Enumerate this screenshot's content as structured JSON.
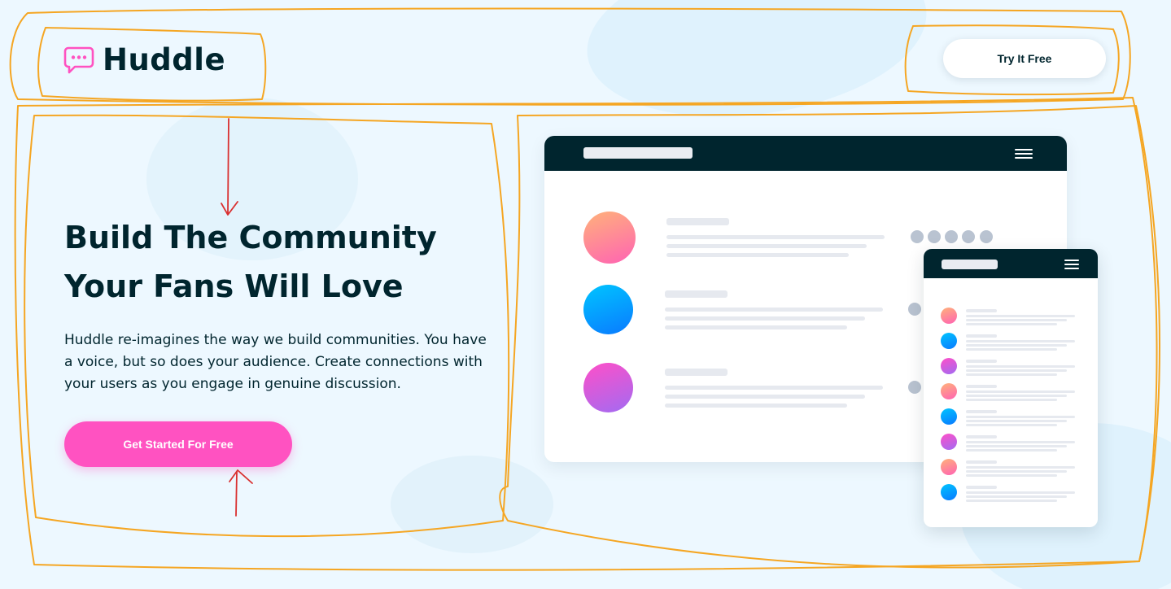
{
  "header": {
    "logo_text": "Huddle",
    "logo_icon": "chat-bubble-icon",
    "cta_label": "Try It Free"
  },
  "hero": {
    "title_line1": "Build The Community",
    "title_line2": "Your Fans Will Love",
    "description": "Huddle re-imagines the way we build communities. You have a voice, but so does your audience. Create connections with your users as you engage in genuine discussion.",
    "cta_label": "Get Started For Free"
  },
  "colors": {
    "primary_dark": "#00252e",
    "accent_pink": "#ff52c1",
    "background": "#edf8ff",
    "annotation_orange": "#f5a623",
    "annotation_red": "#d93030"
  },
  "illustration": {
    "desktop_avatars": [
      "orange-pink-gradient",
      "blue-gradient",
      "purple-pink-gradient"
    ],
    "phone_avatars": [
      "orange",
      "blue",
      "purple",
      "orange",
      "blue",
      "purple",
      "orange",
      "blue"
    ]
  }
}
